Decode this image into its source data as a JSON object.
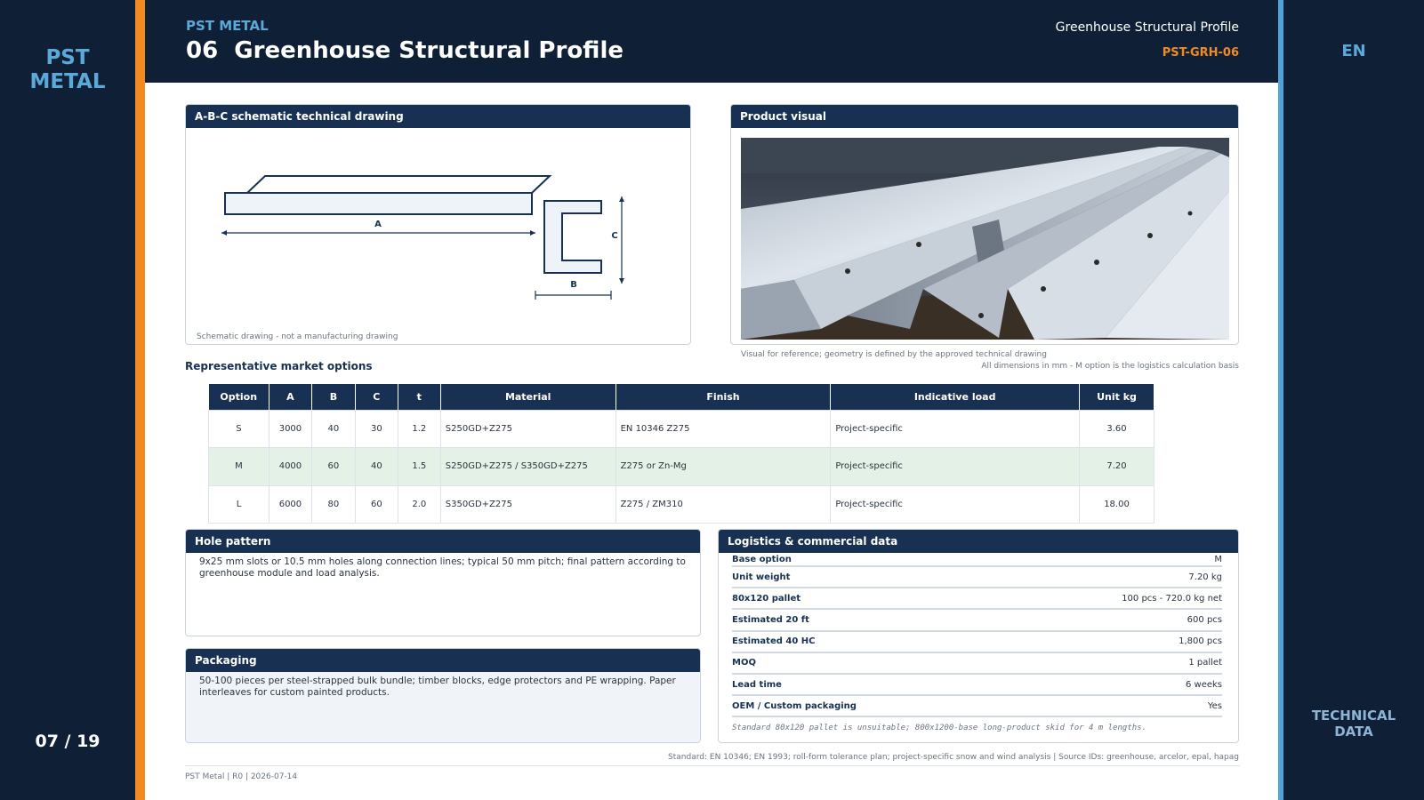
{
  "brand_logo": "PST\nMETAL",
  "page_counter": "07 / 19",
  "language": "EN",
  "right_section": "TECHNICAL\nDATA",
  "header": {
    "brand": "PST METAL",
    "title": "06  Greenhouse Structural Profile",
    "subtitle": "Greenhouse Structural Profile",
    "code": "PST-GRH-06"
  },
  "drawing": {
    "heading": "A-B-C schematic technical drawing",
    "labels": {
      "a": "A",
      "b": "B",
      "c": "C"
    },
    "note": "Schematic drawing - not a manufacturing drawing"
  },
  "visual": {
    "heading": "Product visual",
    "note": "Visual for reference; geometry is defined by the approved technical drawing"
  },
  "dims_note": "All dimensions in mm - M option is the logistics calculation basis",
  "options": {
    "title": "Representative market options",
    "columns": [
      "Option",
      "A",
      "B",
      "C",
      "t",
      "Material",
      "Finish",
      "Indicative load",
      "Unit kg"
    ],
    "rows": [
      [
        "S",
        "3000",
        "40",
        "30",
        "1.2",
        "S250GD+Z275",
        "EN 10346 Z275",
        "Project-specific",
        "3.60"
      ],
      [
        "M",
        "4000",
        "60",
        "40",
        "1.5",
        "S250GD+Z275 / S350GD+Z275",
        "Z275 or Zn-Mg",
        "Project-specific",
        "7.20"
      ],
      [
        "L",
        "6000",
        "80",
        "60",
        "2.0",
        "S350GD+Z275",
        "Z275 / ZM310",
        "Project-specific",
        "18.00"
      ]
    ]
  },
  "hole_pattern": {
    "heading": "Hole pattern",
    "text": "9x25 mm slots or 10.5 mm holes along connection lines; typical 50 mm pitch; final pattern according to greenhouse module and load analysis."
  },
  "packaging": {
    "heading": "Packaging",
    "text": "50-100 pieces per steel-strapped bulk bundle; timber blocks, edge protectors and PE wrapping. Paper interleaves for custom painted products."
  },
  "logistics": {
    "heading": "Logistics & commercial data",
    "rows": [
      [
        "Base option",
        "M"
      ],
      [
        "Unit weight",
        "7.20 kg"
      ],
      [
        "80x120 pallet",
        "100 pcs - 720.0 kg net"
      ],
      [
        "Estimated 20 ft",
        "600 pcs"
      ],
      [
        "Estimated 40 HC",
        "1,800 pcs"
      ],
      [
        "MOQ",
        "1 pallet"
      ],
      [
        "Lead time",
        "6 weeks"
      ],
      [
        "OEM / Custom packaging",
        "Yes"
      ]
    ],
    "note": "Standard 80x120 pallet is unsuitable; 800x1200-base long-product skid for 4 m lengths."
  },
  "standard_line": "Standard: EN 10346; EN 1993; roll-form tolerance plan; project-specific snow and wind analysis | Source IDs: greenhouse, arcelor, epal, hapag",
  "footer": "PST Metal | R0 | 2026-07-14",
  "colors": {
    "navy": "#0f2036",
    "panel_head": "#183152",
    "orange": "#f28a22",
    "blue": "#4fa3d8",
    "row_highlight": "#e4f1e6"
  }
}
